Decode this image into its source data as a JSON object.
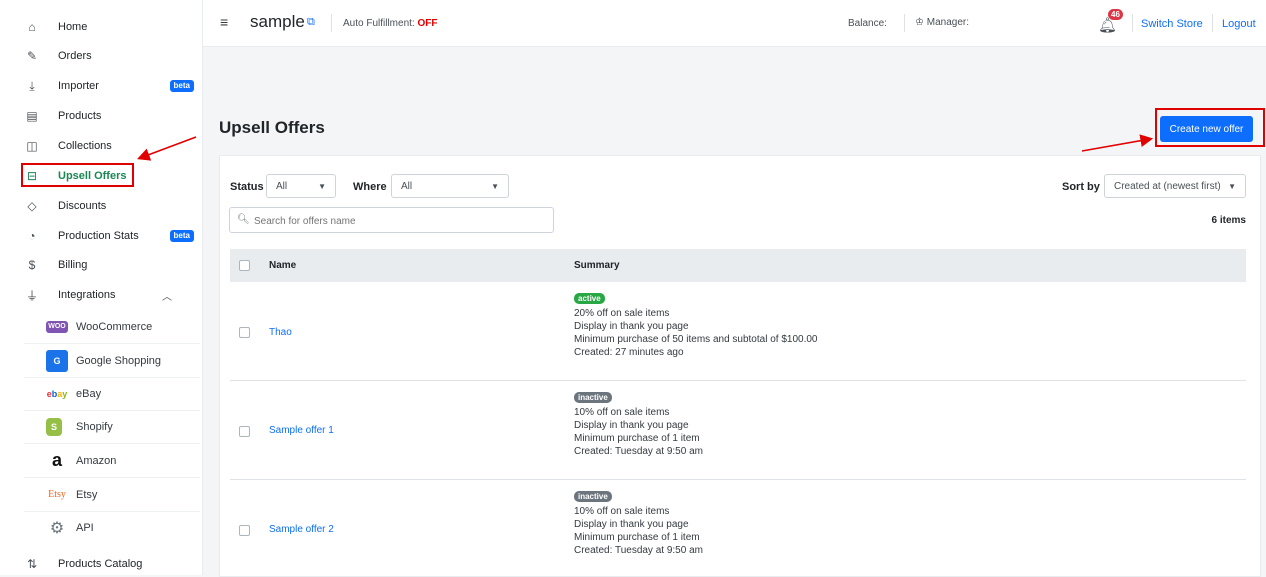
{
  "sidebar": {
    "items": [
      {
        "label": "Home",
        "icon": "home-icon"
      },
      {
        "label": "Orders",
        "icon": "edit-icon"
      },
      {
        "label": "Importer",
        "icon": "download-icon",
        "badge": "beta"
      },
      {
        "label": "Products",
        "icon": "archive-icon"
      },
      {
        "label": "Collections",
        "icon": "box-icon"
      },
      {
        "label": "Upsell Offers",
        "icon": "upsell-icon",
        "active": true
      },
      {
        "label": "Discounts",
        "icon": "tag-icon"
      },
      {
        "label": "Production Stats",
        "icon": "clock-icon",
        "badge": "beta"
      },
      {
        "label": "Billing",
        "icon": "dollar-icon"
      },
      {
        "label": "Integrations",
        "icon": "plug-icon"
      }
    ],
    "integrations": [
      {
        "label": "WooCommerce",
        "logo": "woo"
      },
      {
        "label": "Google Shopping",
        "logo": "google-shopping"
      },
      {
        "label": "eBay",
        "logo": "ebay"
      },
      {
        "label": "Shopify",
        "logo": "shopify"
      },
      {
        "label": "Amazon",
        "logo": "amazon"
      },
      {
        "label": "Etsy",
        "logo": "Etsy"
      },
      {
        "label": "API",
        "logo": "api"
      }
    ],
    "bottom_item": "Products Catalog"
  },
  "topbar": {
    "store_name": "sample",
    "auto_fulfillment_label": "Auto Fulfillment:",
    "auto_fulfillment_value": "OFF",
    "balance_label": "Balance:",
    "manager_label": "Manager:",
    "notification_count": "46",
    "switch_store": "Switch Store",
    "logout": "Logout"
  },
  "page": {
    "title": "Upsell Offers",
    "create_button": "Create new offer"
  },
  "filters": {
    "status_label": "Status",
    "status_value": "All",
    "where_label": "Where",
    "where_value": "All",
    "sort_label": "Sort by",
    "sort_value": "Created at (newest first)",
    "search_placeholder": "Search for offers name",
    "items_count": "6 items"
  },
  "table": {
    "headers": {
      "name": "Name",
      "summary": "Summary"
    },
    "rows": [
      {
        "name": "Thao",
        "status": "active",
        "lines": [
          "20% off on sale items",
          "Display in thank you page",
          "Minimum purchase of 50 items and subtotal of $100.00",
          "Created: 27 minutes ago"
        ]
      },
      {
        "name": "Sample offer 1",
        "status": "inactive",
        "lines": [
          "10% off on sale items",
          "Display in thank you page",
          "Minimum purchase of 1 item",
          "Created: Tuesday at 9:50 am"
        ]
      },
      {
        "name": "Sample offer 2",
        "status": "inactive",
        "lines": [
          "10% off on sale items",
          "Display in thank you page",
          "Minimum purchase of 1 item",
          "Created: Tuesday at 9:50 am"
        ]
      }
    ]
  },
  "colors": {
    "accent": "#0d6efd",
    "active_nav": "#198754",
    "annotation": "#e00000",
    "active_pill": "#28a745",
    "inactive_pill": "#6c757d"
  }
}
